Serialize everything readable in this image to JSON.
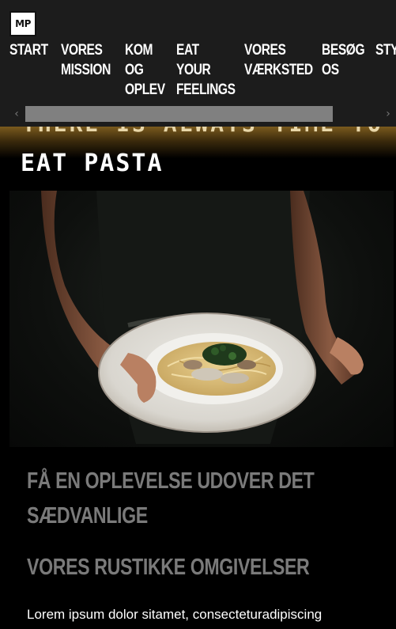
{
  "logo": {
    "text": "MP"
  },
  "nav": {
    "items": [
      {
        "lines": [
          "START"
        ]
      },
      {
        "lines": [
          "VORES",
          "MISSION"
        ]
      },
      {
        "lines": [
          "KOM",
          "OG",
          "OPLEV"
        ]
      },
      {
        "lines": [
          "EAT",
          "YOUR",
          "FEELINGS"
        ]
      },
      {
        "lines": [
          "VORES",
          "VÆRKSTED"
        ]
      },
      {
        "lines": [
          "BESØG",
          "OS"
        ]
      },
      {
        "lines": [
          "STY"
        ]
      }
    ],
    "scroll_left_icon": "chevron-left-icon",
    "scroll_right_icon": "chevron-right-icon"
  },
  "hero": {
    "line1_partial": "THERE IS ALWAYS TIME TO",
    "title": "EAT PASTA",
    "accent_color": "#7a5a1e"
  },
  "photo": {
    "subject": "hands holding plate of pasta"
  },
  "sections": {
    "heading1": "FÅ EN OPLEVELSE UDOVER DET SÆDVANLIGE",
    "heading2": "VORES RUSTIKKE OMGIVELSER",
    "body": "Lorem ipsum dolor sitamet, consecteturadipiscing"
  },
  "colors": {
    "nav_bg": "#1c1c1c",
    "heading_gray": "#7a7a7a",
    "page_bg": "#000000"
  }
}
